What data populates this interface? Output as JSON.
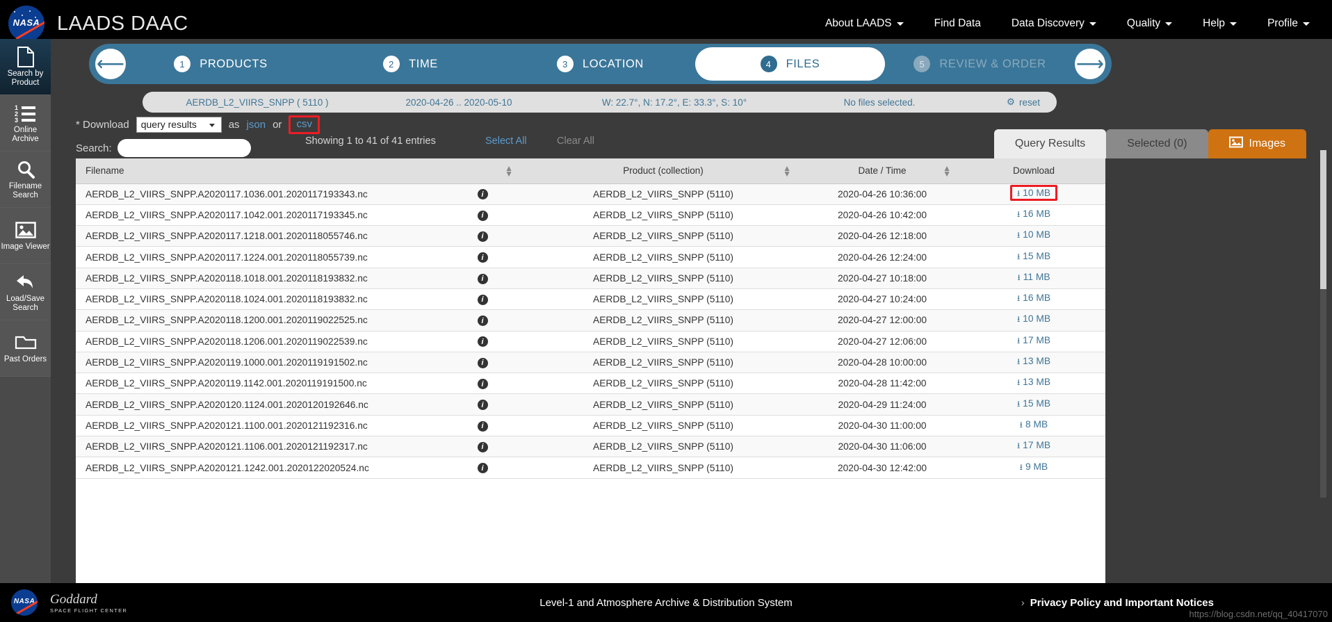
{
  "header": {
    "brand": "LAADS DAAC",
    "logo_text": "NASA",
    "nav": [
      {
        "label": "About LAADS",
        "caret": true
      },
      {
        "label": "Find Data",
        "caret": false
      },
      {
        "label": "Data Discovery",
        "caret": true
      },
      {
        "label": "Quality",
        "caret": true
      },
      {
        "label": "Help",
        "caret": true
      },
      {
        "label": "Profile",
        "caret": true
      }
    ]
  },
  "sidebar": {
    "items": [
      {
        "label": "Search by Product",
        "icon": "document-icon",
        "active": true
      },
      {
        "label": "Online Archive",
        "icon": "ordered-list-icon",
        "active": false
      },
      {
        "label": "Filename Search",
        "icon": "search-icon",
        "active": false
      },
      {
        "label": "Image Viewer",
        "icon": "image-icon",
        "active": false
      },
      {
        "label": "Load/Save Search",
        "icon": "undo-arrow-icon",
        "active": false
      },
      {
        "label": "Past Orders",
        "icon": "folder-icon",
        "active": false
      }
    ]
  },
  "wizard": {
    "back_icon": "arrow-left-circle-icon",
    "forward_icon": "arrow-right-circle-icon",
    "steps": [
      {
        "num": "1",
        "label": "PRODUCTS",
        "state": "done"
      },
      {
        "num": "2",
        "label": "TIME",
        "state": "done"
      },
      {
        "num": "3",
        "label": "LOCATION",
        "state": "done"
      },
      {
        "num": "4",
        "label": "FILES",
        "state": "current"
      },
      {
        "num": "5",
        "label": "REVIEW & ORDER",
        "state": "disabled"
      }
    ]
  },
  "breadcrumb": {
    "product": "AERDB_L2_VIIRS_SNPP ( 5110 )",
    "time": "2020-04-26 .. 2020-05-10",
    "location": "W: 22.7°, N: 17.2°, E: 33.3°, S: 10°",
    "files": "No files selected.",
    "reset": "reset",
    "reset_icon": "gears-icon"
  },
  "controls": {
    "download_label": "* Download",
    "download_select_value": "query results",
    "as_label": "as",
    "json_label": "json",
    "or_label": "or",
    "csv_label": "csv",
    "csv_highlight_color": "#ec1c24",
    "search_label": "Search:",
    "search_value": "",
    "search_placeholder": "",
    "showing": "Showing 1 to 41 of 41 entries",
    "select_all": "Select All",
    "clear_all": "Clear All"
  },
  "tabs": [
    {
      "label": "Query Results",
      "state": "active",
      "icon": null
    },
    {
      "label": "Selected (0)",
      "state": "inactive",
      "icon": null
    },
    {
      "label": "Images",
      "state": "images",
      "icon": "image-icon"
    }
  ],
  "table": {
    "columns": [
      {
        "label": "Filename",
        "sortable": true
      },
      {
        "label": "",
        "sortable": false
      },
      {
        "label": "Product (collection)",
        "sortable": true
      },
      {
        "label": "Date / Time",
        "sortable": true
      },
      {
        "label": "Download",
        "sortable": false
      }
    ],
    "info_icon": "info-circle-icon",
    "download_icon": "download-icon",
    "highlighted_row_index": 0,
    "rows": [
      {
        "filename": "AERDB_L2_VIIRS_SNPP.A2020117.1036.001.2020117193343.nc",
        "product": "AERDB_L2_VIIRS_SNPP (5110)",
        "datetime": "2020-04-26 10:36:00",
        "size": "10 MB"
      },
      {
        "filename": "AERDB_L2_VIIRS_SNPP.A2020117.1042.001.2020117193345.nc",
        "product": "AERDB_L2_VIIRS_SNPP (5110)",
        "datetime": "2020-04-26 10:42:00",
        "size": "16 MB"
      },
      {
        "filename": "AERDB_L2_VIIRS_SNPP.A2020117.1218.001.2020118055746.nc",
        "product": "AERDB_L2_VIIRS_SNPP (5110)",
        "datetime": "2020-04-26 12:18:00",
        "size": "10 MB"
      },
      {
        "filename": "AERDB_L2_VIIRS_SNPP.A2020117.1224.001.2020118055739.nc",
        "product": "AERDB_L2_VIIRS_SNPP (5110)",
        "datetime": "2020-04-26 12:24:00",
        "size": "15 MB"
      },
      {
        "filename": "AERDB_L2_VIIRS_SNPP.A2020118.1018.001.2020118193832.nc",
        "product": "AERDB_L2_VIIRS_SNPP (5110)",
        "datetime": "2020-04-27 10:18:00",
        "size": "11 MB"
      },
      {
        "filename": "AERDB_L2_VIIRS_SNPP.A2020118.1024.001.2020118193832.nc",
        "product": "AERDB_L2_VIIRS_SNPP (5110)",
        "datetime": "2020-04-27 10:24:00",
        "size": "16 MB"
      },
      {
        "filename": "AERDB_L2_VIIRS_SNPP.A2020118.1200.001.2020119022525.nc",
        "product": "AERDB_L2_VIIRS_SNPP (5110)",
        "datetime": "2020-04-27 12:00:00",
        "size": "10 MB"
      },
      {
        "filename": "AERDB_L2_VIIRS_SNPP.A2020118.1206.001.2020119022539.nc",
        "product": "AERDB_L2_VIIRS_SNPP (5110)",
        "datetime": "2020-04-27 12:06:00",
        "size": "17 MB"
      },
      {
        "filename": "AERDB_L2_VIIRS_SNPP.A2020119.1000.001.2020119191502.nc",
        "product": "AERDB_L2_VIIRS_SNPP (5110)",
        "datetime": "2020-04-28 10:00:00",
        "size": "13 MB"
      },
      {
        "filename": "AERDB_L2_VIIRS_SNPP.A2020119.1142.001.2020119191500.nc",
        "product": "AERDB_L2_VIIRS_SNPP (5110)",
        "datetime": "2020-04-28 11:42:00",
        "size": "13 MB"
      },
      {
        "filename": "AERDB_L2_VIIRS_SNPP.A2020120.1124.001.2020120192646.nc",
        "product": "AERDB_L2_VIIRS_SNPP (5110)",
        "datetime": "2020-04-29 11:24:00",
        "size": "15 MB"
      },
      {
        "filename": "AERDB_L2_VIIRS_SNPP.A2020121.1100.001.2020121192316.nc",
        "product": "AERDB_L2_VIIRS_SNPP (5110)",
        "datetime": "2020-04-30 11:00:00",
        "size": "8 MB"
      },
      {
        "filename": "AERDB_L2_VIIRS_SNPP.A2020121.1106.001.2020121192317.nc",
        "product": "AERDB_L2_VIIRS_SNPP (5110)",
        "datetime": "2020-04-30 11:06:00",
        "size": "17 MB"
      },
      {
        "filename": "AERDB_L2_VIIRS_SNPP.A2020121.1242.001.2020122020524.nc",
        "product": "AERDB_L2_VIIRS_SNPP (5110)",
        "datetime": "2020-04-30 12:42:00",
        "size": "9 MB"
      }
    ]
  },
  "footer": {
    "goddard_line1": "Goddard",
    "goddard_line2": "SPACE FLIGHT CENTER",
    "center_text": "Level-1 and Atmosphere Archive & Distribution System",
    "privacy": "Privacy Policy and Important Notices",
    "chevron": "›",
    "watermark": "https://blog.csdn.net/qq_40417070"
  }
}
